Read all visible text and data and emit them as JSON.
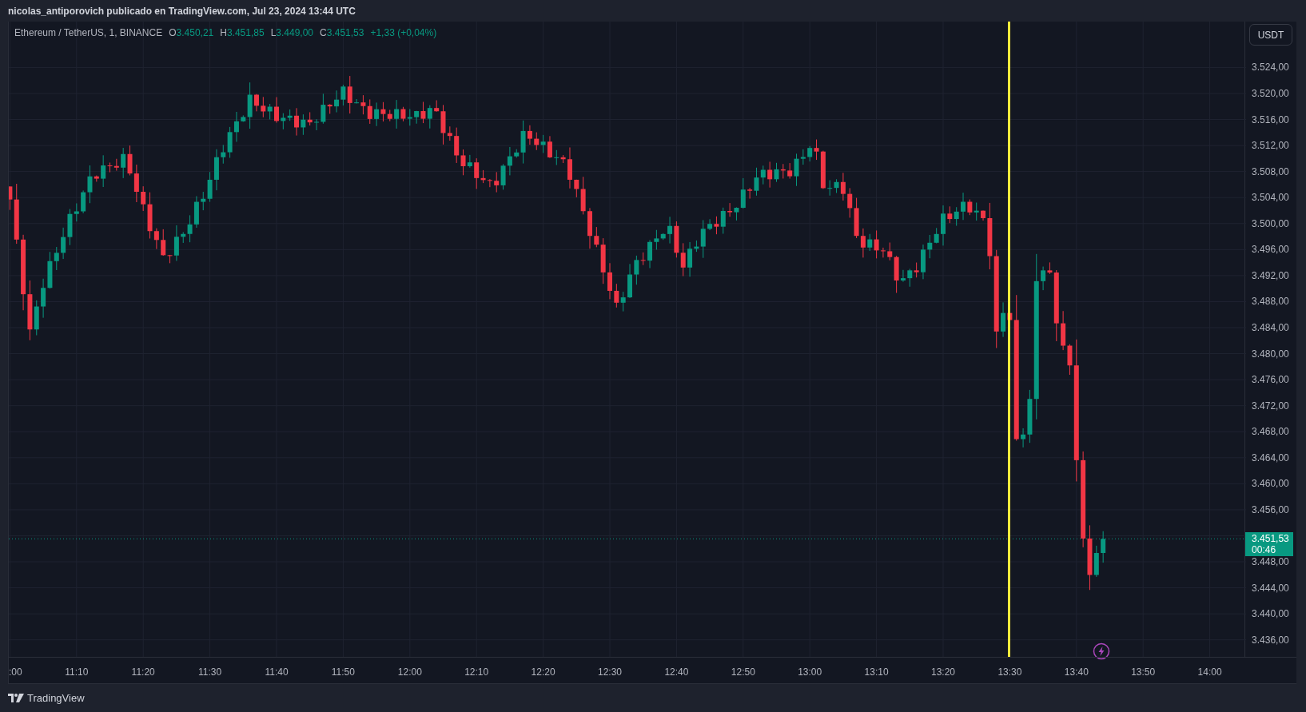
{
  "header": {
    "publisher_line": "nicolas_antiporovich publicado en TradingView.com, Jul 23, 2024 13:44 UTC"
  },
  "legend": {
    "symbol": "Ethereum / TetherUS, 1, BINANCE",
    "values": [
      {
        "label": "O",
        "value": "3.450,21"
      },
      {
        "label": "H",
        "value": "3.451,85"
      },
      {
        "label": "L",
        "value": "3.449,00"
      },
      {
        "label": "C",
        "value": "3.451,53"
      }
    ],
    "change": "+1,33 (+0,04%)"
  },
  "currency_button": "USDT",
  "price_axis": {
    "ticks": [
      "3.524,00",
      "3.520,00",
      "3.516,00",
      "3.512,00",
      "3.508,00",
      "3.504,00",
      "3.500,00",
      "3.496,00",
      "3.492,00",
      "3.488,00",
      "3.484,00",
      "3.480,00",
      "3.476,00",
      "3.472,00",
      "3.468,00",
      "3.464,00",
      "3.460,00",
      "3.456,00",
      "3.448,00",
      "3.444,00",
      "3.440,00",
      "3.436,00"
    ]
  },
  "price_badge": {
    "price": "3.451,53",
    "countdown": "00:46"
  },
  "time_axis": {
    "ticks": [
      ":00",
      "11:10",
      "11:20",
      "11:30",
      "11:40",
      "11:50",
      "12:00",
      "12:10",
      "12:20",
      "12:30",
      "12:40",
      "12:50",
      "13:00",
      "13:10",
      "13:20",
      "13:30",
      "13:40",
      "13:50",
      "14:00"
    ]
  },
  "footer": {
    "logo_text": "TradingView"
  }
}
